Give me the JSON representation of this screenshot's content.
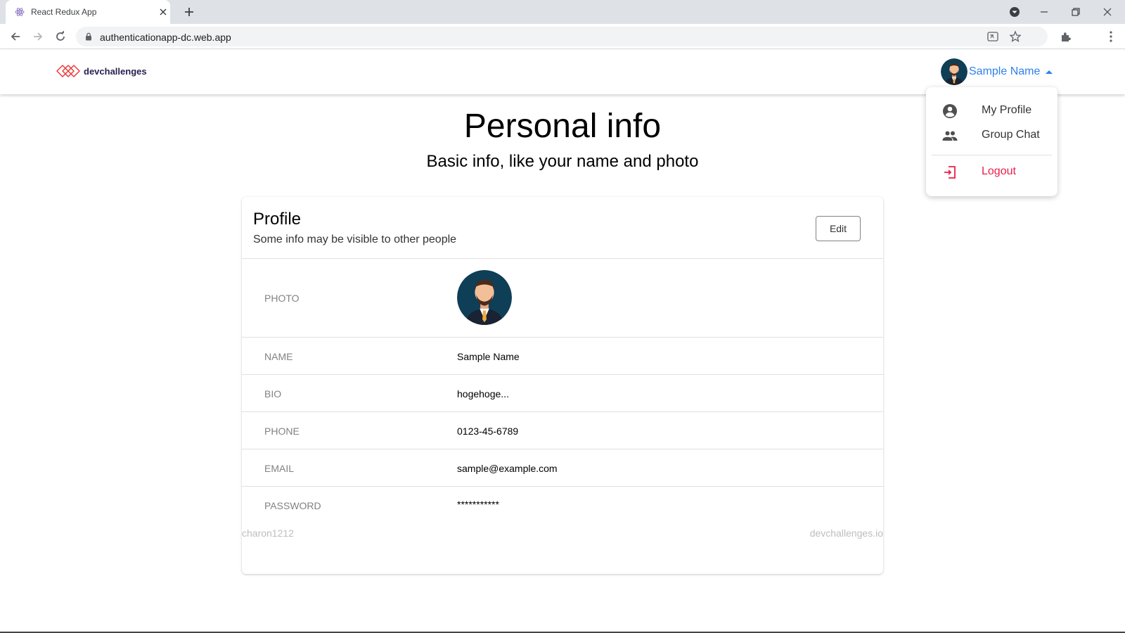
{
  "browser": {
    "tab_title": "React Redux App",
    "url": "authenticationapp-dc.web.app"
  },
  "app": {
    "logo_text": "devchallenges",
    "user_name": "Sample Name"
  },
  "page": {
    "title": "Personal info",
    "subtitle": "Basic info, like your name and photo"
  },
  "profile": {
    "title": "Profile",
    "subtitle": "Some info may be visible to other people",
    "edit_label": "Edit",
    "photo_label": "PHOTO",
    "rows": [
      {
        "label": "NAME",
        "value": "Sample Name"
      },
      {
        "label": "BIO",
        "value": "hogehoge..."
      },
      {
        "label": "PHONE",
        "value": "0123-45-6789"
      },
      {
        "label": "EMAIL",
        "value": "sample@example.com"
      },
      {
        "label": "PASSWORD",
        "value": "***********"
      }
    ]
  },
  "footer": {
    "left": "charon1212",
    "right": "devchallenges.io"
  },
  "menu": {
    "items": [
      {
        "label": "My Profile",
        "icon": "account-circle-icon"
      },
      {
        "label": "Group Chat",
        "icon": "group-icon"
      },
      {
        "label": "Logout",
        "icon": "logout-icon"
      }
    ]
  },
  "colors": {
    "accent": "#2f80ed",
    "logout": "#eb1d4b",
    "muted": "#828282"
  }
}
